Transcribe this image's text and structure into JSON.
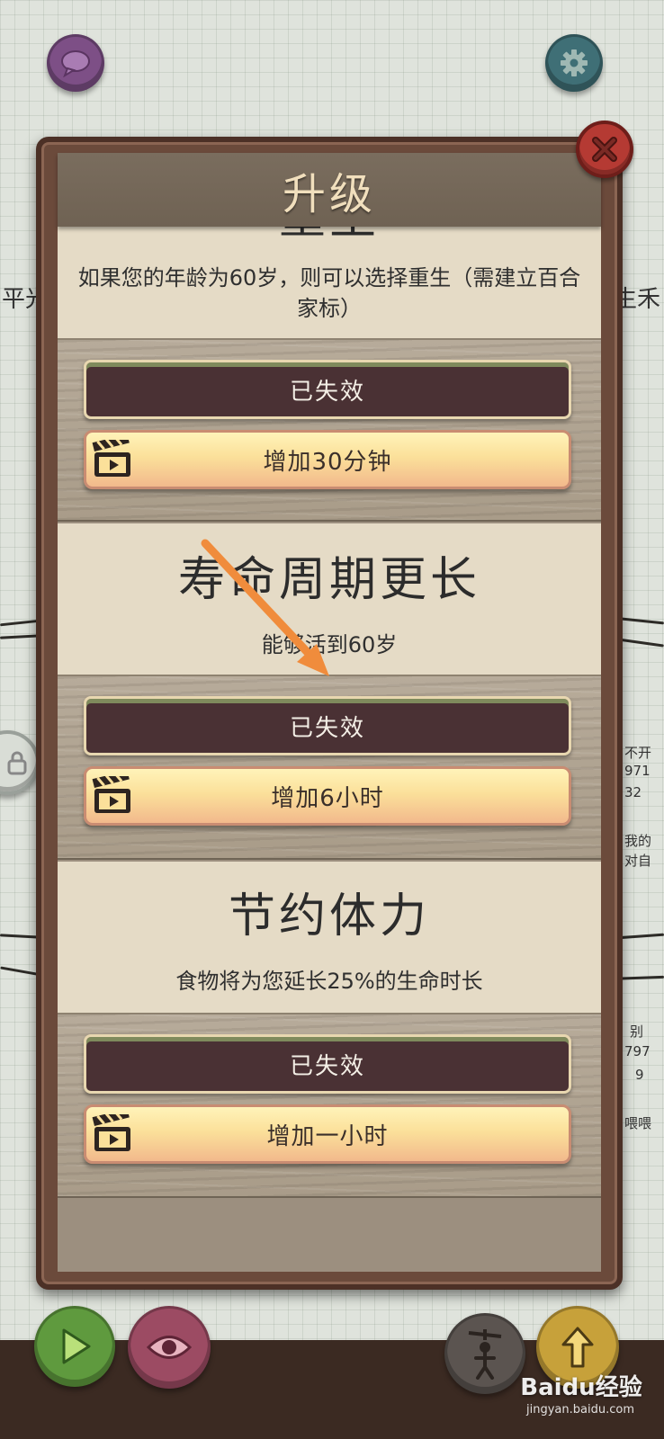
{
  "background": {
    "left_fragment": "平光",
    "right_fragment": "生禾",
    "right_side_lines": [
      "不开",
      "971",
      "32",
      "我的",
      "对自",
      "别",
      "797",
      "9",
      "喂喂"
    ]
  },
  "modal": {
    "title": "升级",
    "upgrades": [
      {
        "title_partial": "重生",
        "description": "如果您的年龄为60岁，则可以选择重生（需建立百合家标）",
        "status_label": "已失效",
        "action_label": "增加30分钟"
      },
      {
        "title": "寿命周期更长",
        "description": "能够活到60岁",
        "status_label": "已失效",
        "action_label": "增加6小时"
      },
      {
        "title": "节约体力",
        "description": "食物将为您延长25%的生命时长",
        "status_label": "已失效",
        "action_label": "增加一小时"
      }
    ]
  },
  "watermark": {
    "brand": "Baidu经验",
    "url": "jingyan.baidu.com"
  },
  "colors": {
    "chat_button": "#7d4f86",
    "settings_button": "#3f6f76",
    "close_button": "#b53a33",
    "play_button": "#5f9a3e",
    "eye_button": "#9c4b63",
    "expired_button": "#4a3134",
    "action_button": "#fbe09a",
    "annotation_arrow": "#f08c3c"
  },
  "icons": [
    "chat-icon",
    "gear-icon",
    "close-icon",
    "clapperboard-icon",
    "play-icon",
    "eye-icon",
    "lock-icon",
    "puppet-icon",
    "upgrade-arrow-icon"
  ]
}
